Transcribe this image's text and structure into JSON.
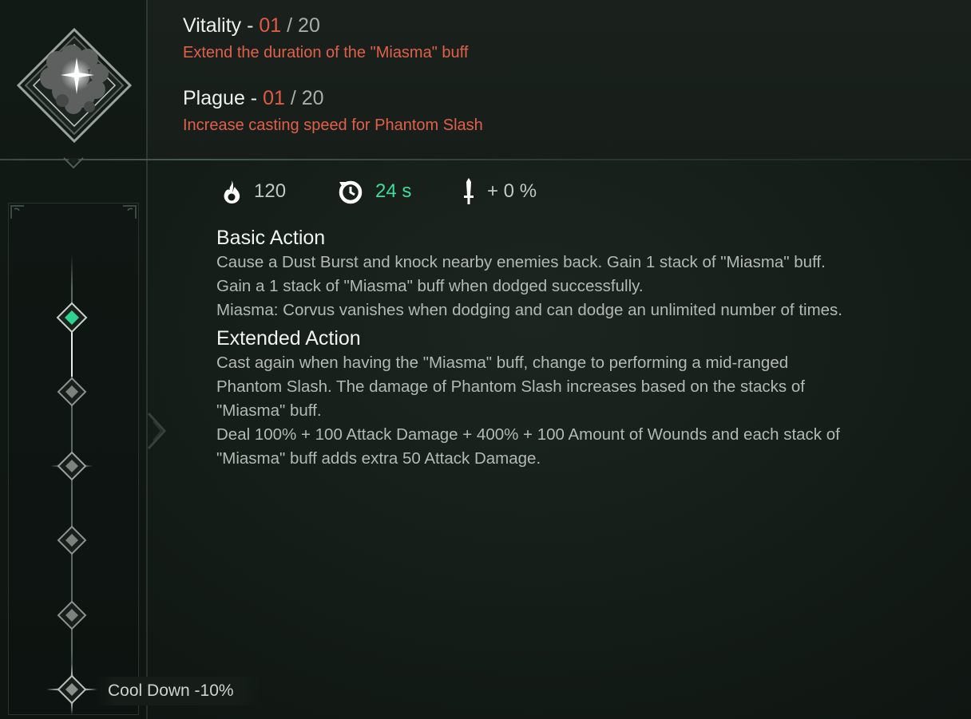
{
  "attributes": [
    {
      "name": "Vitality",
      "separator": " - ",
      "level": "01",
      "max": " / 20",
      "description": "Extend the duration of the \"Miasma\" buff"
    },
    {
      "name": "Plague",
      "separator": " - ",
      "level": "01",
      "max": " / 20",
      "description": "Increase casting speed for Phantom Slash"
    }
  ],
  "stats": {
    "energy": {
      "icon": "flame-icon",
      "value": "120"
    },
    "cooldown": {
      "icon": "cooldown-clock-icon",
      "value": "24 s",
      "color": "#3fdc9a"
    },
    "damage": {
      "icon": "sword-icon",
      "value": "+ 0 %"
    }
  },
  "basic_action": {
    "title": "Basic Action",
    "lines": [
      "Cause a Dust Burst and knock nearby enemies back. Gain 1 stack of \"Miasma\" buff.",
      "Gain a 1 stack of \"Miasma\" buff when dodged successfully.",
      "Miasma: Corvus vanishes when dodging and can dodge an unlimited number of times."
    ]
  },
  "extended_action": {
    "title": "Extended Action",
    "lines": [
      "Cast again when having the \"Miasma\" buff, change to performing a mid-ranged",
      "Phantom Slash.  The damage of Phantom Slash increases based on the stacks of",
      "\"Miasma\" buff.",
      "Deal 100% + 100 Attack Damage + 400% + 100 Amount of Wounds and each stack of",
      "\"Miasma\" buff adds extra 50 Attack Damage."
    ]
  },
  "ladder": {
    "bonus_label": "Cool Down -10%",
    "active_node_color": "#2fd38f"
  },
  "colors": {
    "accent_red": "#e05a45",
    "accent_green": "#3fdc9a"
  }
}
